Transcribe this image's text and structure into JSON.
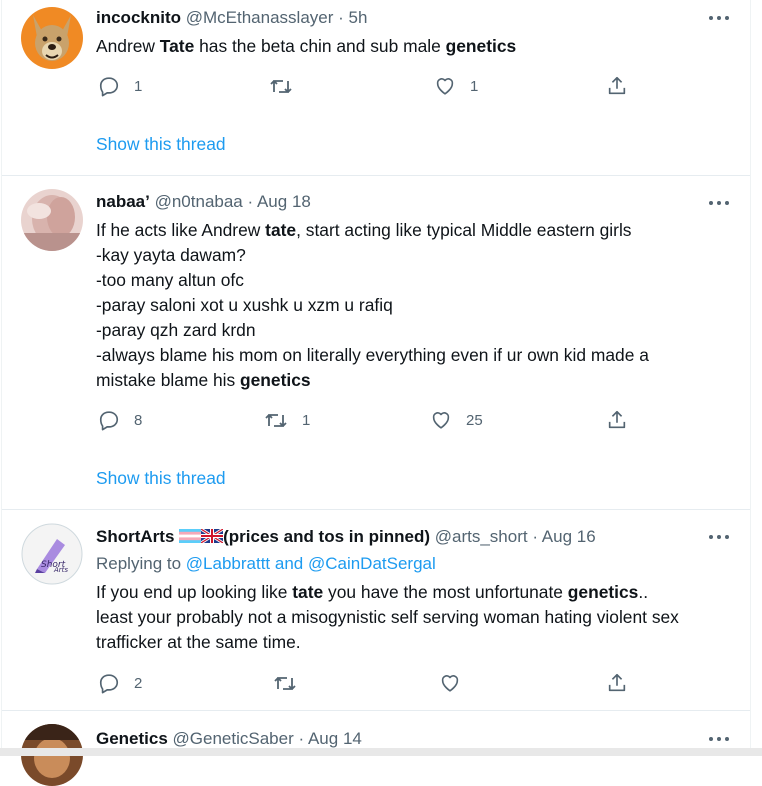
{
  "tweets": [
    {
      "name": "incocknito",
      "handle": "@McEthanasslayer",
      "sep": "·",
      "time": "5h",
      "text_parts": [
        "Andrew ",
        "Tate",
        " has the beta chin and sub male ",
        "genetics"
      ],
      "reply_count": "1",
      "retweet_count": "",
      "like_count": "1",
      "show_thread": "Show this thread"
    },
    {
      "name": "nabaa’",
      "handle": "@n0tnabaa",
      "sep": "·",
      "time": "Aug 18",
      "text_parts": [
        "If he acts like Andrew ",
        "tate",
        ", start acting like typical Middle eastern girls"
      ],
      "lines": [
        "-kay yayta dawam?",
        "-too many altun ofc",
        "-paray saloni xot u xushk u xzm u rafiq",
        "-paray qzh zard krdn",
        "-always blame his mom on literally everything even if ur own kid made a"
      ],
      "last_line_parts": [
        "mistake blame his ",
        "genetics"
      ],
      "reply_count": "8",
      "retweet_count": "1",
      "like_count": "25",
      "show_thread": "Show this thread"
    },
    {
      "name": "ShortArts",
      "name_suffix": "(prices and tos in pinned)",
      "handle": "@arts_short",
      "sep": "·",
      "time": "Aug 16",
      "replying_prefix": "Replying to ",
      "replying_users": "@Labbrattt and @CainDatSergal",
      "text_parts": [
        "If you end up looking like ",
        "tate",
        " you have the most unfortunate ",
        "genetics",
        ".."
      ],
      "lines": [
        "least your probably not a misogynistic self serving woman hating violent sex",
        "trafficker at the same time."
      ],
      "reply_count": "2",
      "retweet_count": "",
      "like_count": ""
    },
    {
      "name": "Genetics",
      "handle": "@GeneticSaber",
      "sep": "·",
      "time": "Aug 14"
    }
  ],
  "colors": {
    "accent": "#1d9bf0",
    "muted": "#536471",
    "text": "#0f1419"
  },
  "icons": [
    "reply-icon",
    "retweet-icon",
    "like-icon",
    "share-icon",
    "more-icon"
  ]
}
